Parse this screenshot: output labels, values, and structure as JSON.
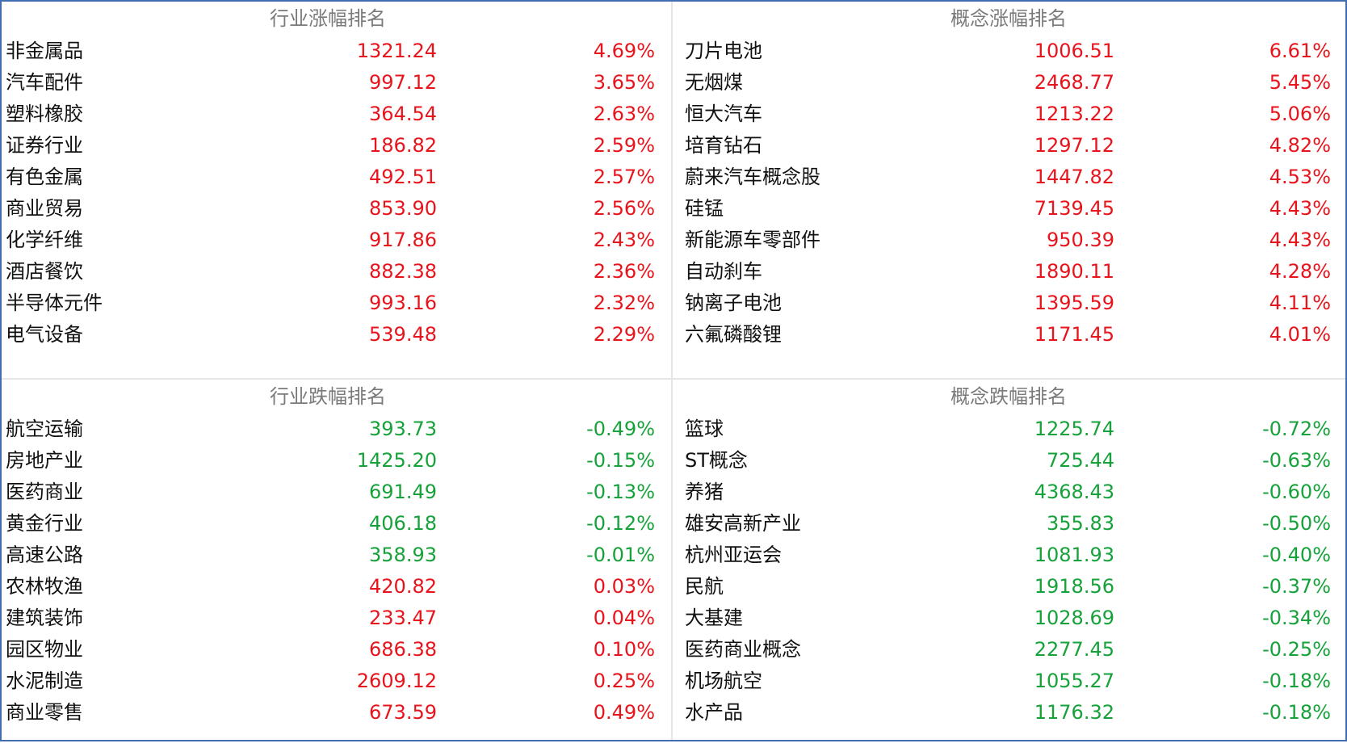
{
  "colors": {
    "up": "#e8141c",
    "down": "#16a23a",
    "border": "#3f6fb0"
  },
  "panels": {
    "industry_gain": {
      "title": "行业涨幅排名",
      "rows": [
        {
          "name": "非金属品",
          "value": "1321.24",
          "pct": "4.69%",
          "dir": "up"
        },
        {
          "name": "汽车配件",
          "value": "997.12",
          "pct": "3.65%",
          "dir": "up"
        },
        {
          "name": "塑料橡胶",
          "value": "364.54",
          "pct": "2.63%",
          "dir": "up"
        },
        {
          "name": "证券行业",
          "value": "186.82",
          "pct": "2.59%",
          "dir": "up"
        },
        {
          "name": "有色金属",
          "value": "492.51",
          "pct": "2.57%",
          "dir": "up"
        },
        {
          "name": "商业贸易",
          "value": "853.90",
          "pct": "2.56%",
          "dir": "up"
        },
        {
          "name": "化学纤维",
          "value": "917.86",
          "pct": "2.43%",
          "dir": "up"
        },
        {
          "name": "酒店餐饮",
          "value": "882.38",
          "pct": "2.36%",
          "dir": "up"
        },
        {
          "name": "半导体元件",
          "value": "993.16",
          "pct": "2.32%",
          "dir": "up"
        },
        {
          "name": "电气设备",
          "value": "539.48",
          "pct": "2.29%",
          "dir": "up"
        }
      ]
    },
    "concept_gain": {
      "title": "概念涨幅排名",
      "rows": [
        {
          "name": "刀片电池",
          "value": "1006.51",
          "pct": "6.61%",
          "dir": "up"
        },
        {
          "name": "无烟煤",
          "value": "2468.77",
          "pct": "5.45%",
          "dir": "up"
        },
        {
          "name": "恒大汽车",
          "value": "1213.22",
          "pct": "5.06%",
          "dir": "up"
        },
        {
          "name": "培育钻石",
          "value": "1297.12",
          "pct": "4.82%",
          "dir": "up"
        },
        {
          "name": "蔚来汽车概念股",
          "value": "1447.82",
          "pct": "4.53%",
          "dir": "up"
        },
        {
          "name": "硅锰",
          "value": "7139.45",
          "pct": "4.43%",
          "dir": "up"
        },
        {
          "name": "新能源车零部件",
          "value": "950.39",
          "pct": "4.43%",
          "dir": "up"
        },
        {
          "name": "自动刹车",
          "value": "1890.11",
          "pct": "4.28%",
          "dir": "up"
        },
        {
          "name": "钠离子电池",
          "value": "1395.59",
          "pct": "4.11%",
          "dir": "up"
        },
        {
          "name": "六氟磷酸锂",
          "value": "1171.45",
          "pct": "4.01%",
          "dir": "up"
        }
      ]
    },
    "industry_loss": {
      "title": "行业跌幅排名",
      "rows": [
        {
          "name": "航空运输",
          "value": "393.73",
          "pct": "-0.49%",
          "dir": "down"
        },
        {
          "name": "房地产业",
          "value": "1425.20",
          "pct": "-0.15%",
          "dir": "down"
        },
        {
          "name": "医药商业",
          "value": "691.49",
          "pct": "-0.13%",
          "dir": "down"
        },
        {
          "name": "黄金行业",
          "value": "406.18",
          "pct": "-0.12%",
          "dir": "down"
        },
        {
          "name": "高速公路",
          "value": "358.93",
          "pct": "-0.01%",
          "dir": "down"
        },
        {
          "name": "农林牧渔",
          "value": "420.82",
          "pct": "0.03%",
          "dir": "up"
        },
        {
          "name": "建筑装饰",
          "value": "233.47",
          "pct": "0.04%",
          "dir": "up"
        },
        {
          "name": "园区物业",
          "value": "686.38",
          "pct": "0.10%",
          "dir": "up"
        },
        {
          "name": "水泥制造",
          "value": "2609.12",
          "pct": "0.25%",
          "dir": "up"
        },
        {
          "name": "商业零售",
          "value": "673.59",
          "pct": "0.49%",
          "dir": "up"
        }
      ]
    },
    "concept_loss": {
      "title": "概念跌幅排名",
      "rows": [
        {
          "name": "篮球",
          "value": "1225.74",
          "pct": "-0.72%",
          "dir": "down"
        },
        {
          "name": "ST概念",
          "value": "725.44",
          "pct": "-0.63%",
          "dir": "down"
        },
        {
          "name": "养猪",
          "value": "4368.43",
          "pct": "-0.60%",
          "dir": "down"
        },
        {
          "name": "雄安高新产业",
          "value": "355.83",
          "pct": "-0.50%",
          "dir": "down"
        },
        {
          "name": "杭州亚运会",
          "value": "1081.93",
          "pct": "-0.40%",
          "dir": "down"
        },
        {
          "name": "民航",
          "value": "1918.56",
          "pct": "-0.37%",
          "dir": "down"
        },
        {
          "name": "大基建",
          "value": "1028.69",
          "pct": "-0.34%",
          "dir": "down"
        },
        {
          "name": "医药商业概念",
          "value": "2277.45",
          "pct": "-0.25%",
          "dir": "down"
        },
        {
          "name": "机场航空",
          "value": "1055.27",
          "pct": "-0.18%",
          "dir": "down"
        },
        {
          "name": "水产品",
          "value": "1176.32",
          "pct": "-0.18%",
          "dir": "down"
        }
      ]
    }
  }
}
